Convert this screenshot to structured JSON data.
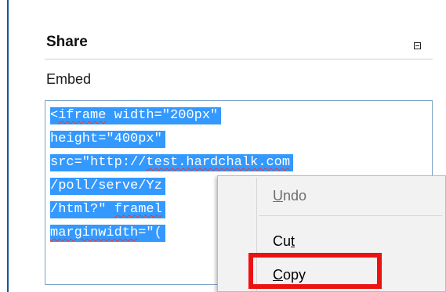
{
  "panel": {
    "title": "Share",
    "collapse_icon": "collapse-minus-icon",
    "embed_label": "Embed"
  },
  "embed_code": {
    "line1": {
      "a": "<",
      "b": "iframe",
      "c": " width=\"200px\""
    },
    "line2": "height=\"400px\"",
    "line3": {
      "a": "src=\"http://",
      "b": "test.hardchalk.com"
    },
    "line4": "/poll/serve/Yz",
    "line5": {
      "a": "/html?\" ",
      "b": "framel"
    },
    "line6": {
      "a": "marginwidth",
      "b": "=\"("
    }
  },
  "context_menu": {
    "undo": {
      "before": "",
      "accel": "U",
      "after": "ndo"
    },
    "cut": {
      "before": "Cu",
      "accel": "t",
      "after": ""
    },
    "copy": {
      "before": "",
      "accel": "C",
      "after": "opy"
    }
  },
  "colors": {
    "selection": "#3399ff",
    "highlight_box": "#ee1111",
    "left_rule": "#0b5a9c"
  }
}
